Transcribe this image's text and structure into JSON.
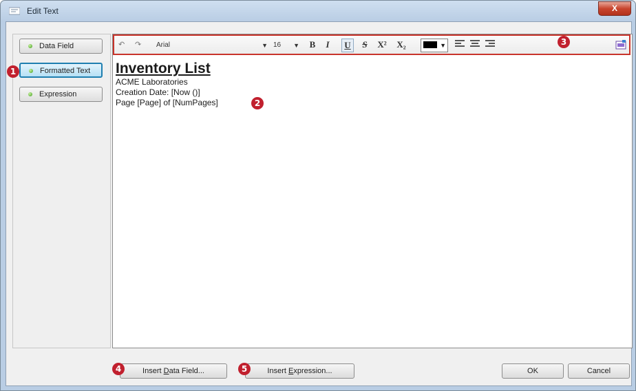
{
  "window": {
    "title": "Edit Text",
    "close_label": "X"
  },
  "modes": [
    {
      "label": "Data Field",
      "active": false
    },
    {
      "label": "Formatted Text",
      "active": true
    },
    {
      "label": "Expression",
      "active": false
    }
  ],
  "toolbar": {
    "undo_icon": "undo-icon",
    "redo_icon": "redo-icon",
    "font_name": "Arial",
    "font_size": "16",
    "bold": "B",
    "italic": "I",
    "underline": "U",
    "strike": "S",
    "superscript": "X²",
    "subscript": "X₂",
    "text_color": "#000000",
    "align_icons": [
      "align-left-icon",
      "align-center-icon",
      "align-right-icon"
    ]
  },
  "document": {
    "heading": "Inventory List",
    "lines": [
      "ACME Laboratories",
      "Creation Date: [Now ()]",
      "Page [Page] of [NumPages]"
    ]
  },
  "callouts": [
    "1",
    "2",
    "3",
    "4",
    "5"
  ],
  "buttons": {
    "insert_data_field_pre": "Insert ",
    "insert_data_field_key": "D",
    "insert_data_field_post": "ata Field...",
    "insert_expression_pre": "Insert ",
    "insert_expression_key": "E",
    "insert_expression_post": "xpression...",
    "ok": "OK",
    "cancel": "Cancel"
  },
  "colors": {
    "callout_red": "#c1202e",
    "active_mode": "#1f7fb0",
    "close_button": "#c8452e"
  }
}
